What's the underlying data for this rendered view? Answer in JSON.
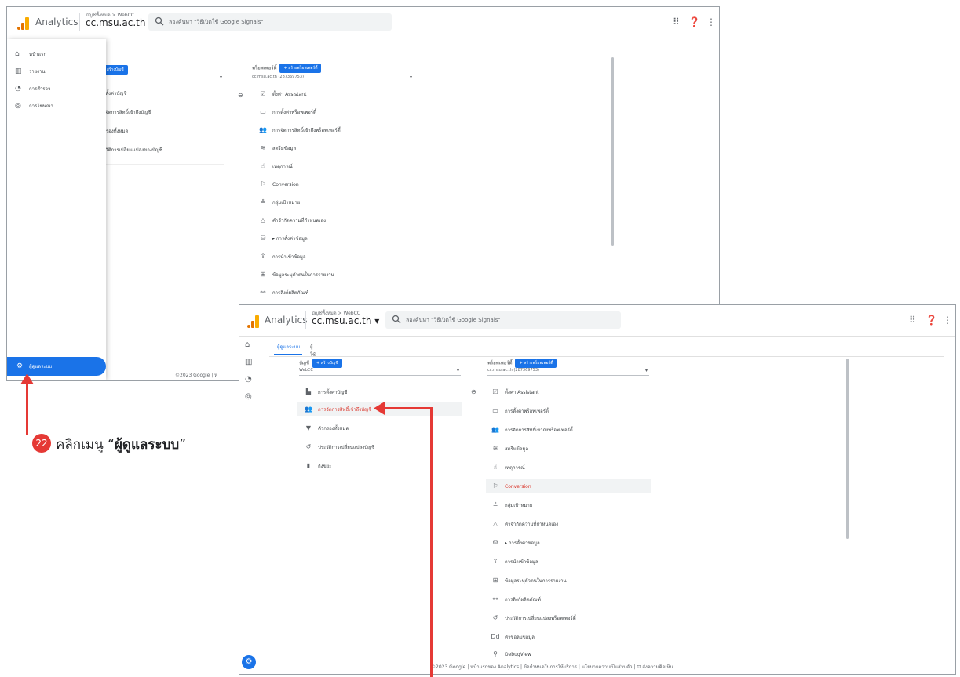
{
  "window1": {
    "brand": "Analytics",
    "breadcrumb": "บัญชีทั้งหมด > WebCC",
    "property": "cc.msu.ac.th",
    "search_placeholder": "ลองค้นหา \"วิธีเปิดใช้ Google Signals\"",
    "drawer": {
      "items": [
        {
          "label": "หน้าแรก",
          "icon": "home-icon"
        },
        {
          "label": "รายงาน",
          "icon": "bar-chart-icon"
        },
        {
          "label": "การสำรวจ",
          "icon": "explore-icon"
        },
        {
          "label": "การโฆษณา",
          "icon": "ads-icon"
        }
      ],
      "admin_label": "ผู้ดูแลระบบ"
    },
    "account_col": {
      "button": "+ สร้างบัญชี",
      "items": [
        "การตั้งค่าบัญชี",
        "การจัดการสิทธิ์เข้าถึงบัญชี",
        "ตัวกรองทั้งหมด",
        "ประวัติการเปลี่ยนแปลงของบัญชี"
      ]
    },
    "property_col": {
      "label": "พร็อพเพอร์ตี้",
      "button": "+ สร้างพร็อพเพอร์ตี้",
      "select": "cc.msu.ac.th (287369753)",
      "items": [
        "ตั้งค่า Assistant",
        "การตั้งค่าพร็อพเพอร์ตี้",
        "การจัดการสิทธิ์เข้าถึงพร็อพเพอร์ตี้",
        "สตรีมข้อมูล",
        "เหตุการณ์",
        "Conversion",
        "กลุ่มเป้าหมาย",
        "คำจำกัดความที่กำหนดเอง",
        "▸ การตั้งค่าข้อมูล",
        "การนำเข้าข้อมูล",
        "ข้อมูลระบุตัวตนในการรายงาน",
        "การลิงก์ผลิตภัณฑ์"
      ]
    },
    "footer": "©2023 Google | ห"
  },
  "window2": {
    "brand": "Analytics",
    "breadcrumb": "บัญชีทั้งหมด > WebCC",
    "property": "cc.msu.ac.th",
    "search_placeholder": "ลองค้นหา \"วิธีเปิดใช้ Google Signals\"",
    "tabs": [
      "ผู้ดูแลระบบ",
      "ผู้ใช้"
    ],
    "account_col": {
      "label": "บัญชี",
      "button": "+ สร้างบัญชี",
      "select": "WebCC",
      "items": [
        {
          "label": "การตั้งค่าบัญชี",
          "icon": "building-icon"
        },
        {
          "label": "การจัดการสิทธิ์เข้าถึงบัญชี",
          "icon": "people-icon"
        },
        {
          "label": "ตัวกรองทั้งหมด",
          "icon": "filter-icon"
        },
        {
          "label": "ประวัติการเปลี่ยนแปลงบัญชี",
          "icon": "history-icon"
        },
        {
          "label": "ถังขยะ",
          "icon": "trash-icon"
        }
      ]
    },
    "property_col": {
      "label": "พร็อพเพอร์ตี้",
      "button": "+ สร้างพร็อพเพอร์ตี้",
      "select": "cc.msu.ac.th (287369753)",
      "items": [
        {
          "label": "ตั้งค่า Assistant",
          "icon": "check-box-icon"
        },
        {
          "label": "การตั้งค่าพร็อพเพอร์ตี้",
          "icon": "property-icon"
        },
        {
          "label": "การจัดการสิทธิ์เข้าถึงพร็อพเพอร์ตี้",
          "icon": "people-icon"
        },
        {
          "label": "สตรีมข้อมูล",
          "icon": "stream-icon"
        },
        {
          "label": "เหตุการณ์",
          "icon": "touch-icon"
        },
        {
          "label": "Conversion",
          "icon": "flag-icon"
        },
        {
          "label": "กลุ่มเป้าหมาย",
          "icon": "audience-icon"
        },
        {
          "label": "คำจำกัดความที่กำหนดเอง",
          "icon": "shapes-icon"
        },
        {
          "label": "▸ การตั้งค่าข้อมูล",
          "icon": "database-icon"
        },
        {
          "label": "การนำเข้าข้อมูล",
          "icon": "upload-icon"
        },
        {
          "label": "ข้อมูลระบุตัวตนในการรายงาน",
          "icon": "identity-icon"
        },
        {
          "label": "การลิงก์ผลิตภัณฑ์",
          "icon": "link-icon"
        },
        {
          "label": "ประวัติการเปลี่ยนแปลงพร็อพเพอร์ตี้",
          "icon": "history-icon"
        },
        {
          "label": "คำขอลบข้อมูล",
          "icon": "dd-icon"
        },
        {
          "label": "DebugView",
          "icon": "debug-icon"
        }
      ]
    },
    "footer": "©2023 Google | หน้าแรกของ Analytics | ข้อกำหนดในการให้บริการ | นโยบายความเป็นส่วนตัว | ⊡ ส่งความคิดเห็น"
  },
  "annotation": {
    "step": "22",
    "text_prefix": "คลิกเมนู",
    "text_bold": "ผู้ดูแลระบบ",
    "color": "#e53935"
  }
}
